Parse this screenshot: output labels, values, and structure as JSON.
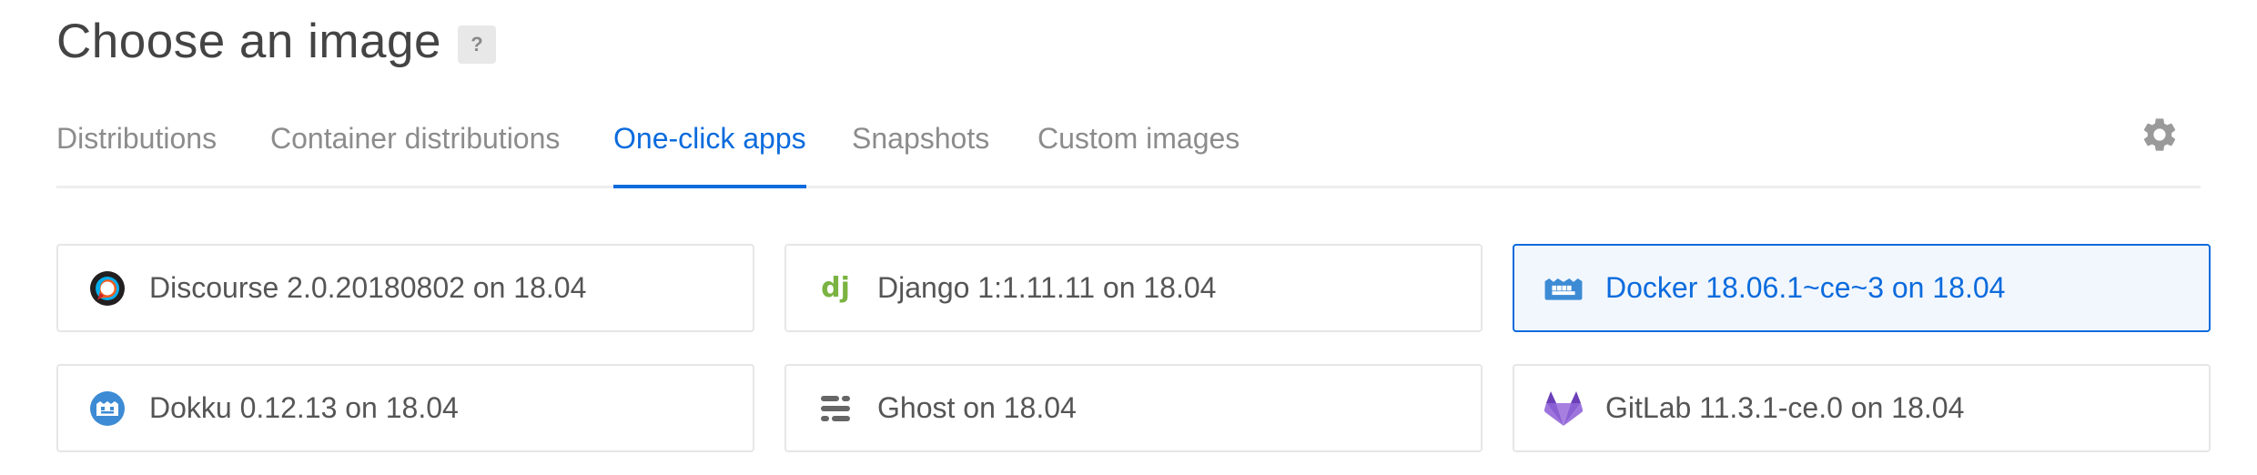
{
  "header": {
    "title": "Choose an image",
    "help_label": "?"
  },
  "tabs": [
    {
      "label": "Distributions",
      "active": false
    },
    {
      "label": "Container distributions",
      "active": false
    },
    {
      "label": "One-click apps",
      "active": true
    },
    {
      "label": "Snapshots",
      "active": false
    },
    {
      "label": "Custom images",
      "active": false
    }
  ],
  "settings_icon": "gear-icon",
  "apps": [
    {
      "label": "Discourse 2.0.20180802 on 18.04",
      "icon": "discourse-icon",
      "selected": false
    },
    {
      "label": "Django 1:1.11.11 on 18.04",
      "icon": "django-icon",
      "selected": false
    },
    {
      "label": "Docker 18.06.1~ce~3 on 18.04",
      "icon": "docker-icon",
      "selected": true
    },
    {
      "label": "Dokku 0.12.13 on 18.04",
      "icon": "dokku-icon",
      "selected": false
    },
    {
      "label": "Ghost on 18.04",
      "icon": "ghost-icon",
      "selected": false
    },
    {
      "label": "GitLab 11.3.1-ce.0 on 18.04",
      "icon": "gitlab-icon",
      "selected": false
    }
  ],
  "colors": {
    "accent": "#0b6bdd",
    "tab_inactive": "#8c8c8c",
    "card_border": "#e6e6e6",
    "selected_bg": "#f2f7fe"
  }
}
